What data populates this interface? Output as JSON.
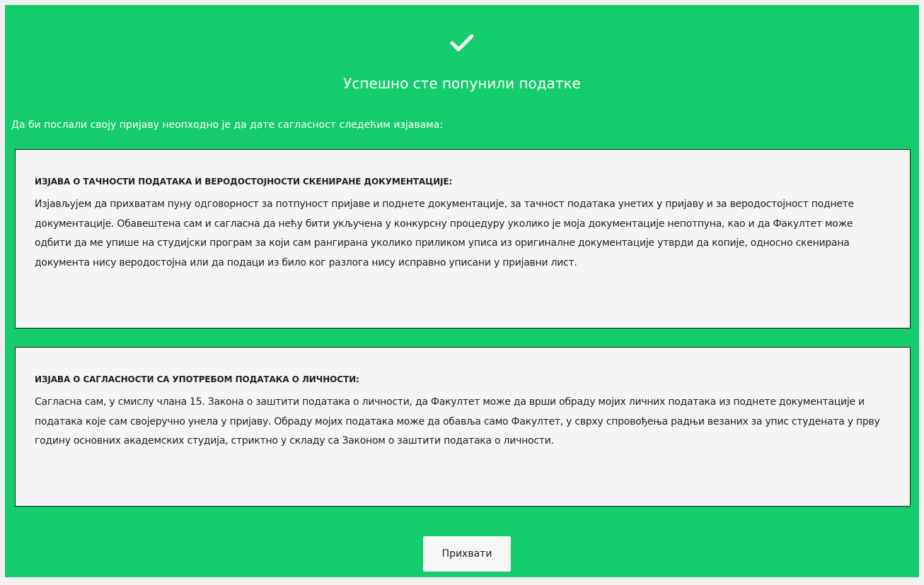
{
  "success": {
    "icon": "check-icon",
    "title": "Успешно сте попунили податке",
    "intro": "Да би послали своју пријаву неопходно је да дате сагласност следећим изјавама:"
  },
  "statements": [
    {
      "heading": "ИЗЈАВА О ТАЧНОСТИ ПОДАТАКА И ВЕРОДОСТОЈНОСТИ СКЕНИРАНЕ ДОКУМЕНТАЦИЈЕ:",
      "body": "Изјављујем да прихватам пуну одговорност за потпуност пријаве и поднете документације, за тачност података унетих у пријаву и за веродостојност поднете документације. Обавештена сам и сагласна да нећу бити укључена у конкурсну процедуру уколико је моја документације непотпуна, као и да Факултет може одбити да ме упише на студијски програм за који сам рангирана уколико приликом уписа из оригиналне документације утврди да копије, односно скенирана документа нису веродостојна или да подаци из било ког разлога нису исправно уписани у пријавни лист."
    },
    {
      "heading": "ИЗЈАВА О САГЛАСНОСТИ СА УПОТРЕБОМ ПОДАТАКА О ЛИЧНОСТИ:",
      "body": "Сагласна сам, у смислу члана 15. Закона о заштити података о личности, да Факултет може да врши обраду мојих личних података из поднете документације и података које сам својеручно унела у пријаву. Обраду мојих података може да обавља само Факултет, у сврху спровођења радњи везаних за упис студената у прву годину основних академских студија, стриктно у складу са Законом о заштити података о личности."
    }
  ],
  "actions": {
    "accept_label": "Прихвати"
  },
  "colors": {
    "panel_background": "#14cc6c",
    "statement_background": "#f5f5f5",
    "text_on_green": "#ffffff"
  }
}
